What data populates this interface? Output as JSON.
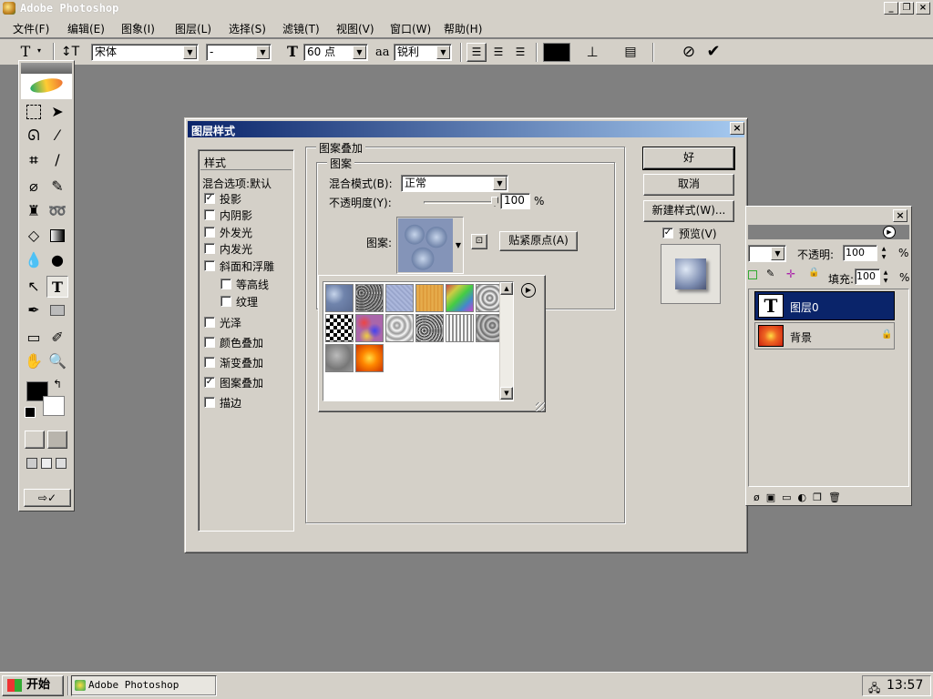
{
  "window": {
    "title": "Adobe Photoshop"
  },
  "menu": [
    "文件(F)",
    "编辑(E)",
    "图象(I)",
    "图层(L)",
    "选择(S)",
    "滤镜(T)",
    "视图(V)",
    "窗口(W)",
    "帮助(H)"
  ],
  "options_bar": {
    "font_family": "宋体",
    "font_style": "-",
    "font_size": "60 点",
    "anti_alias_label": "aa",
    "anti_alias": "锐利",
    "color": "#000000"
  },
  "dialog": {
    "title": "图层样式",
    "styles_header": "样式",
    "blend_options": "混合选项:默认",
    "styles": [
      {
        "label": "投影",
        "checked": true
      },
      {
        "label": "内阴影",
        "checked": false
      },
      {
        "label": "外发光",
        "checked": false
      },
      {
        "label": "内发光",
        "checked": false
      },
      {
        "label": "斜面和浮雕",
        "checked": false
      },
      {
        "label": "等高线",
        "checked": false
      },
      {
        "label": "纹理",
        "checked": false
      },
      {
        "label": "光泽",
        "checked": false
      },
      {
        "label": "颜色叠加",
        "checked": false
      },
      {
        "label": "渐变叠加",
        "checked": false
      },
      {
        "label": "图案叠加",
        "checked": true
      },
      {
        "label": "描边",
        "checked": false
      }
    ],
    "section_title": "图案叠加",
    "group_title": "图案",
    "blend_mode_label": "混合模式(B):",
    "blend_mode_value": "正常",
    "opacity_label": "不透明度(Y):",
    "opacity_value": "100",
    "opacity_unit": "%",
    "opacity_level": 100,
    "pattern_label": "图案:",
    "snap_origin": "贴紧原点(A)",
    "ok": "好",
    "cancel": "取消",
    "new_style": "新建样式(W)...",
    "preview_label": "预览(V)",
    "preview_checked": true
  },
  "layers_panel": {
    "opacity_label": "不透明:",
    "opacity_value": "100",
    "opacity_unit": "%",
    "fill_label": "填充:",
    "fill_value": "100",
    "fill_unit": "%",
    "layers": [
      {
        "name": "图层0",
        "thumb": "T",
        "selected": true
      },
      {
        "name": "背景",
        "thumb": "",
        "selected": false,
        "locked": true
      }
    ]
  },
  "taskbar": {
    "start_label": "开始",
    "task_label": "Adobe Photoshop",
    "clock": "13:57"
  }
}
